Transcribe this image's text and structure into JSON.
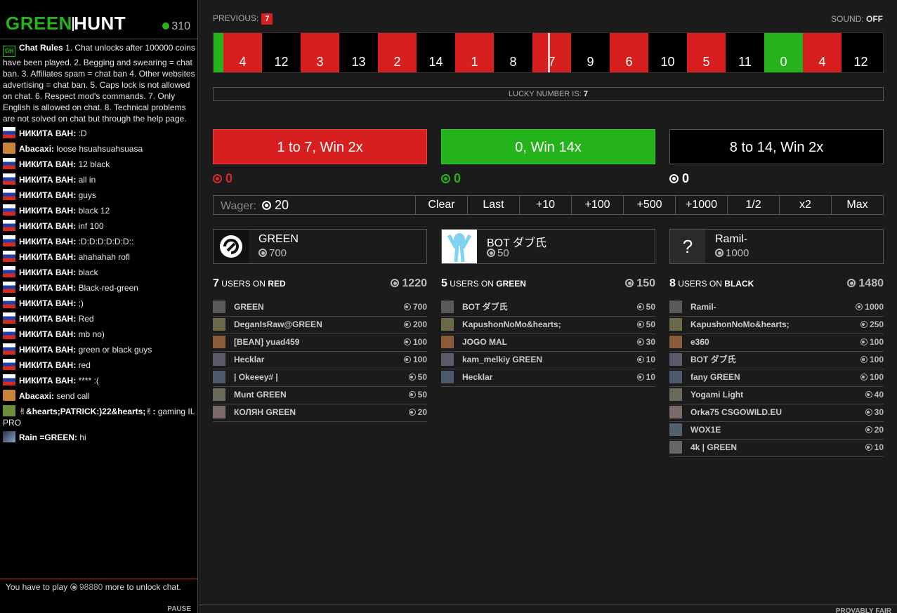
{
  "logo": {
    "text_pre": "GREEN",
    "text_post": "HUNT"
  },
  "online": "310",
  "chat": {
    "rules_label": "Chat Rules",
    "rules_text": "1. Chat unlocks after 100000 coins have been played. 2. Begging and swearing = chat ban. 3. Affiliates spam = chat ban 4. Other websites advertising = chat ban. 5. Caps lock is not allowed on chat. 6. Respect mod's commands. 7. Only English is allowed on chat. 8. Technical problems are not solved on chat but through the help page.",
    "messages": [
      {
        "user": "НИКИТА ВАН:",
        "text": ":D",
        "avatar": "flag"
      },
      {
        "user": "Abacaxi:",
        "text": "loose hsuahsuahsuasa",
        "avatar": "ab"
      },
      {
        "user": "НИКИТА ВАН:",
        "text": "12 black",
        "avatar": "flag"
      },
      {
        "user": "НИКИТА ВАН:",
        "text": "all in",
        "avatar": "flag"
      },
      {
        "user": "НИКИТА ВАН:",
        "text": "guys",
        "avatar": "flag"
      },
      {
        "user": "НИКИТА ВАН:",
        "text": "black 12",
        "avatar": "flag"
      },
      {
        "user": "НИКИТА ВАН:",
        "text": "inf 100",
        "avatar": "flag"
      },
      {
        "user": "НИКИТА ВАН:",
        "text": ":D:D:D:D:D:D::",
        "avatar": "flag"
      },
      {
        "user": "НИКИТА ВАН:",
        "text": "ahahahah rofl",
        "avatar": "flag"
      },
      {
        "user": "НИКИТА ВАН:",
        "text": "black",
        "avatar": "flag"
      },
      {
        "user": "НИКИТА ВАН:",
        "text": "Black-red-green",
        "avatar": "flag"
      },
      {
        "user": "НИКИТА ВАН:",
        "text": ";)",
        "avatar": "flag"
      },
      {
        "user": "НИКИТА ВАН:",
        "text": "Red",
        "avatar": "flag"
      },
      {
        "user": "НИКИТА ВАН:",
        "text": "mb no)",
        "avatar": "flag"
      },
      {
        "user": "НИКИТА ВАН:",
        "text": "green or black guys",
        "avatar": "flag"
      },
      {
        "user": "НИКИТА ВАН:",
        "text": "red",
        "avatar": "flag"
      },
      {
        "user": "НИКИТА ВАН:",
        "text": "**** :(",
        "avatar": "flag"
      },
      {
        "user": "Abacaxi:",
        "text": "send call",
        "avatar": "ab"
      },
      {
        "user": "✌&hearts;PATRICK:)22&hearts;✌:",
        "text": "gaming IL PRO",
        "avatar": "pt"
      },
      {
        "user": "Rain =GREEN:",
        "text": "hi",
        "avatar": "rn"
      }
    ],
    "locked_pre": "You have to play",
    "locked_amount": "98880",
    "locked_post": "more to unlock chat.",
    "pause": "PAUSE"
  },
  "header": {
    "previous_label": "PREVIOUS:",
    "previous_value": "7",
    "sound_label": "SOUND:",
    "sound_value": "OFF"
  },
  "wheel": {
    "tiles": [
      {
        "n": "4",
        "c": "red"
      },
      {
        "n": "12",
        "c": "black"
      },
      {
        "n": "3",
        "c": "red"
      },
      {
        "n": "13",
        "c": "black"
      },
      {
        "n": "2",
        "c": "red"
      },
      {
        "n": "14",
        "c": "black"
      },
      {
        "n": "1",
        "c": "red"
      },
      {
        "n": "8",
        "c": "black"
      },
      {
        "n": "7",
        "c": "red"
      },
      {
        "n": "9",
        "c": "black"
      },
      {
        "n": "6",
        "c": "red"
      },
      {
        "n": "10",
        "c": "black"
      },
      {
        "n": "5",
        "c": "red"
      },
      {
        "n": "11",
        "c": "black"
      },
      {
        "n": "0",
        "c": "green"
      },
      {
        "n": "4",
        "c": "red"
      },
      {
        "n": "12",
        "c": "black"
      }
    ]
  },
  "lucky": {
    "label": "LUCKY NUMBER IS:",
    "value": "7"
  },
  "bets": {
    "red_label": "1 to 7, Win 2x",
    "green_label": "0, Win 14x",
    "black_label": "8 to 14, Win 2x",
    "red_total": "0",
    "green_total": "0",
    "black_total": "0"
  },
  "wager": {
    "label": "Wager:",
    "amount": "20",
    "buttons": [
      "Clear",
      "Last",
      "+10",
      "+100",
      "+500",
      "+1000",
      "1/2",
      "x2",
      "Max"
    ]
  },
  "top_bettors": {
    "red": {
      "name": "GREEN",
      "amount": "700"
    },
    "green": {
      "name": "BOT ダブ氏",
      "amount": "50"
    },
    "black": {
      "name": "Ramil-",
      "amount": "1000",
      "avatar_glyph": "?"
    }
  },
  "columns": {
    "red": {
      "count": "7",
      "users_on": "USERS ON",
      "color_word": "RED",
      "sum": "1220",
      "rows": [
        {
          "name": "GREEN",
          "amount": "700"
        },
        {
          "name": "DeganIsRaw@GREEN",
          "amount": "200"
        },
        {
          "name": "[BEAN] yuad459",
          "amount": "100"
        },
        {
          "name": "Hecklar",
          "amount": "100"
        },
        {
          "name": "| Okeeey# |",
          "amount": "50"
        },
        {
          "name": "Munt GREEN",
          "amount": "50"
        },
        {
          "name": "КОЛЯН GREEN",
          "amount": "20"
        }
      ]
    },
    "green": {
      "count": "5",
      "users_on": "USERS ON",
      "color_word": "GREEN",
      "sum": "150",
      "rows": [
        {
          "name": "BOT ダブ氏",
          "amount": "50"
        },
        {
          "name": "KapushonNoMo&hearts;",
          "amount": "50"
        },
        {
          "name": "JOGO MAL",
          "amount": "30"
        },
        {
          "name": "kam_melkiy GREEN",
          "amount": "10"
        },
        {
          "name": "Hecklar",
          "amount": "10"
        }
      ]
    },
    "black": {
      "count": "8",
      "users_on": "USERS ON",
      "color_word": "BLACK",
      "sum": "1480",
      "rows": [
        {
          "name": "Ramil-",
          "amount": "1000"
        },
        {
          "name": "KapushonNoMo&hearts;",
          "amount": "250"
        },
        {
          "name": "e360",
          "amount": "100"
        },
        {
          "name": "BOT ダブ氏",
          "amount": "100"
        },
        {
          "name": "fany GREEN",
          "amount": "100"
        },
        {
          "name": "Yogami Light",
          "amount": "40"
        },
        {
          "name": "Orka75 CSGOWILD.EU",
          "amount": "30"
        },
        {
          "name": "WOX1E",
          "amount": "20"
        },
        {
          "name": "4k | GREEN",
          "amount": "10"
        }
      ]
    }
  },
  "footer": {
    "provably_fair": "PROVABLY FAIR"
  },
  "colors": {
    "red": "#d71f1f",
    "green": "#25b31c",
    "black": "#000000"
  }
}
